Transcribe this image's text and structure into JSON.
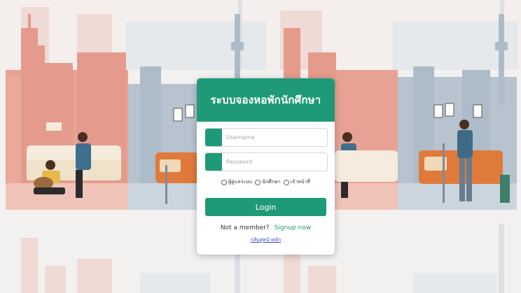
{
  "login": {
    "title": "ระบบจองหอพักนักศึกษา",
    "username_placeholder": "Username",
    "password_placeholder": "Password",
    "roles": [
      "ผู้ดูแลระบบ",
      "นักศึกษา",
      "เจ้าหน้าที่"
    ],
    "login_button": "Login",
    "not_member": "Not a member?",
    "signup": "Signup now",
    "back_home": "กลับสู่หน้าหลัก"
  },
  "colors": {
    "primary": "#1f9a78",
    "salmon": "#e8a293",
    "blue_grey": "#b7c3cf",
    "link_blue": "#3b47c7"
  }
}
